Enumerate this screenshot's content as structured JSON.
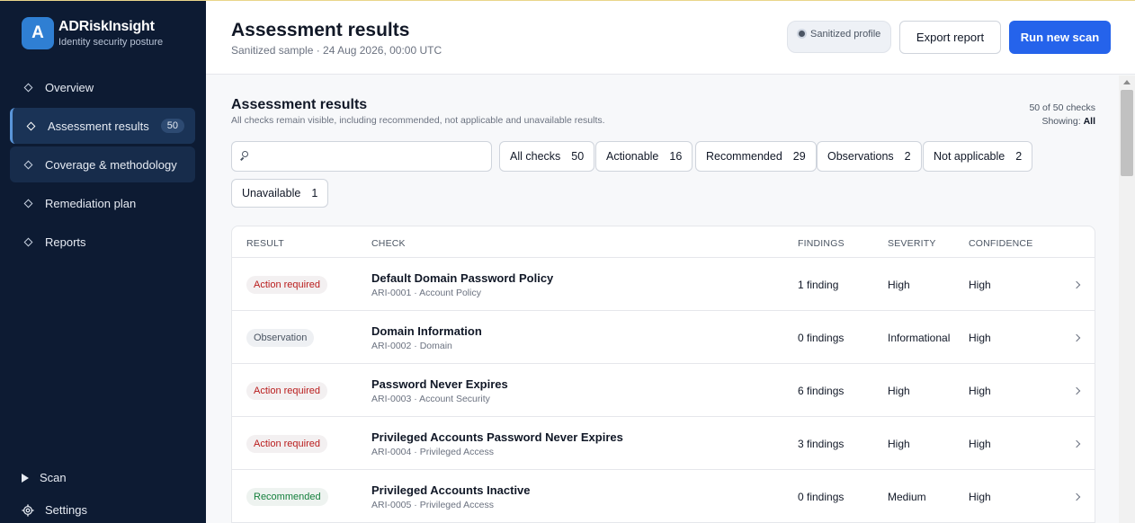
{
  "brand": {
    "logo_letter": "A",
    "name": "ADRiskInsight",
    "tagline": "Identity security posture"
  },
  "nav": {
    "items": [
      {
        "label": "Overview"
      },
      {
        "label": "Assessment results",
        "count": "50"
      },
      {
        "label": "Coverage & methodology"
      },
      {
        "label": "Remediation plan"
      },
      {
        "label": "Reports"
      }
    ],
    "bottom": [
      {
        "label": "Scan"
      },
      {
        "label": "Settings"
      }
    ]
  },
  "header": {
    "title": "Assessment results",
    "subtitle": "Sanitized sample · 24 Aug 2026, 00:00 UTC",
    "profile_pill": "Sanitized profile",
    "export_label": "Export report",
    "run_label": "Run new scan"
  },
  "section": {
    "title": "Assessment results",
    "subtitle": "All checks remain visible, including recommended, not applicable and unavailable results.",
    "count_text": "50 of 50 checks",
    "showing_label": "Showing:",
    "showing_value": "All"
  },
  "search": {
    "value": "",
    "placeholder": ""
  },
  "filters": [
    {
      "label": "All checks",
      "count": "50"
    },
    {
      "label": "Actionable",
      "count": "16"
    },
    {
      "label": "Recommended",
      "count": "29"
    },
    {
      "label": "Observations",
      "count": "2"
    },
    {
      "label": "Not applicable",
      "count": "2"
    },
    {
      "label": "Unavailable",
      "count": "1"
    }
  ],
  "table": {
    "columns": [
      "RESULT",
      "CHECK",
      "FINDINGS",
      "SEVERITY",
      "CONFIDENCE"
    ],
    "rows": [
      {
        "result": "Action required",
        "result_type": "action",
        "name": "Default Domain Password Policy",
        "meta": "ARI-0001 · Account Policy",
        "findings": "1 finding",
        "severity": "High",
        "confidence": "High"
      },
      {
        "result": "Observation",
        "result_type": "obs",
        "name": "Domain Information",
        "meta": "ARI-0002 · Domain",
        "findings": "0 findings",
        "severity": "Informational",
        "confidence": "High"
      },
      {
        "result": "Action required",
        "result_type": "action",
        "name": "Password Never Expires",
        "meta": "ARI-0003 · Account Security",
        "findings": "6 findings",
        "severity": "High",
        "confidence": "High"
      },
      {
        "result": "Action required",
        "result_type": "action",
        "name": "Privileged Accounts Password Never Expires",
        "meta": "ARI-0004 · Privileged Access",
        "findings": "3 findings",
        "severity": "High",
        "confidence": "High"
      },
      {
        "result": "Recommended",
        "result_type": "rec",
        "name": "Privileged Accounts Inactive",
        "meta": "ARI-0005 · Privileged Access",
        "findings": "0 findings",
        "severity": "Medium",
        "confidence": "High"
      }
    ]
  },
  "colors": {
    "sidebar_bg": "#0d1b33",
    "accent": "#2563eb",
    "action_text": "#b91c1c",
    "recommended_text": "#15803d"
  }
}
